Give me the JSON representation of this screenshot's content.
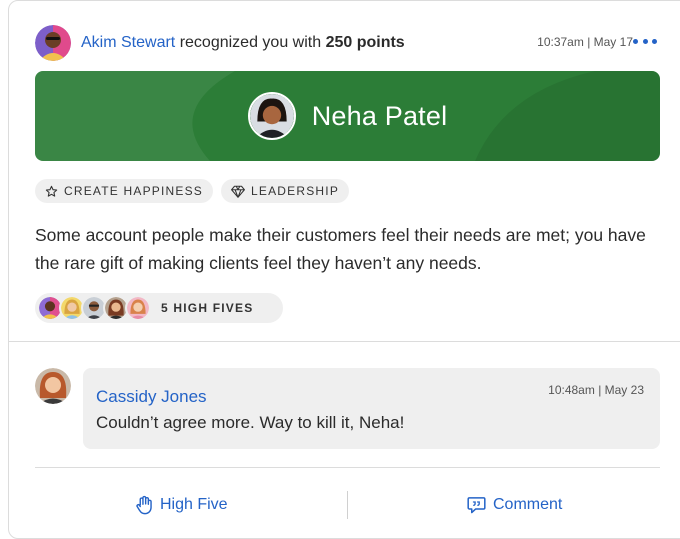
{
  "post": {
    "sender_name": "Akim Stewart",
    "action_text": " recognized you with ",
    "points_text": "250 points",
    "timestamp": "10:37am | May 17",
    "more_icon": "more-horizontal-icon"
  },
  "banner": {
    "recipient_name": "Neha Patel",
    "color": "#2c7d37"
  },
  "tags": [
    {
      "label": "CREATE HAPPINESS",
      "icon": "star-icon"
    },
    {
      "label": "LEADERSHIP",
      "icon": "diamond-icon"
    }
  ],
  "message": "Some account people make their customers feel their needs are met; you have the rare gift of making clients feel they haven’t any needs.",
  "high_fives": {
    "label": "5 HIGH FIVES"
  },
  "comment": {
    "author": "Cassidy Jones",
    "timestamp": "10:48am | May 23",
    "text": "Couldn’t agree more. Way to kill it, Neha!"
  },
  "actions": {
    "high_five_label": "High Five",
    "high_five_icon": "hand-icon",
    "comment_label": "Comment",
    "comment_icon": "comment-icon"
  },
  "colors": {
    "accent": "#2463c7",
    "banner": "#2c7d37",
    "chip_bg": "#efefef"
  }
}
